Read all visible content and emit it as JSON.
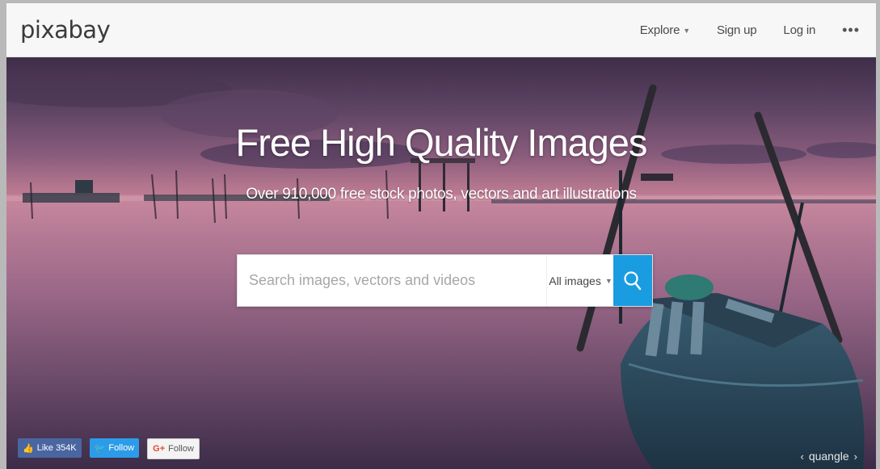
{
  "header": {
    "logo": "pixabay",
    "nav": {
      "explore": "Explore",
      "signup": "Sign up",
      "login": "Log in",
      "more": "•••"
    }
  },
  "hero": {
    "title": "Free High Quality Images",
    "subtitle": "Over 910,000 free stock photos, vectors and art illustrations",
    "search": {
      "placeholder": "Search images, vectors and videos",
      "value": "",
      "type_selected": "All images",
      "button_color": "#1a9ce0"
    }
  },
  "social": {
    "facebook": "Like 354K",
    "twitter": "Follow",
    "google": "Follow"
  },
  "credit": {
    "prev": "‹",
    "author": "quangle",
    "next": "›"
  },
  "colors": {
    "accent": "#1a9ce0",
    "facebook": "#4a66a0",
    "twitter": "#2d9ce8"
  }
}
